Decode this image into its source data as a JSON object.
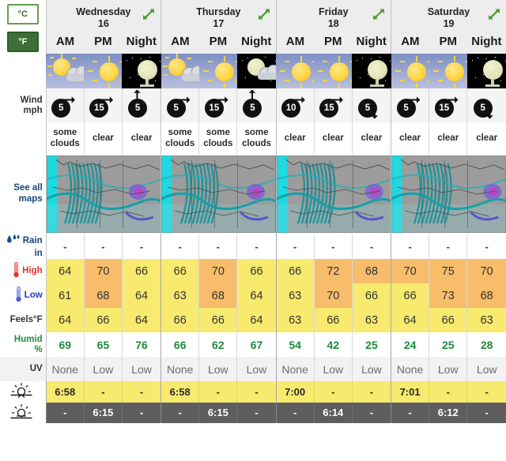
{
  "units": {
    "celsius_label": "°C",
    "fahrenheit_label": "°F",
    "selected": "°F"
  },
  "row_labels": {
    "wind": "Wind",
    "wind_unit": "mph",
    "see_all_maps": "See all\nmaps",
    "see_all_maps_line1": "See all",
    "see_all_maps_line2": "maps",
    "rain": "Rain",
    "rain_unit": "in",
    "high": "High",
    "low": "Low",
    "feels": "Feels°F",
    "humid": "Humid",
    "humid_unit": "%",
    "uv": "UV",
    "sunrise": "sunrise-icon",
    "sunset": "sunset-icon"
  },
  "days": [
    {
      "name": "Wednesday",
      "date": "16",
      "periods": [
        "AM",
        "PM",
        "Night"
      ],
      "sky": [
        "sun-cloud",
        "sun",
        "moon"
      ],
      "wind_speed": [
        "5",
        "15",
        "5"
      ],
      "wind_dir": [
        "ne",
        "ne",
        "n"
      ],
      "conditions": [
        "some clouds",
        "clear",
        "clear"
      ],
      "rain": [
        "-",
        "-",
        "-"
      ],
      "high": [
        "64",
        "70",
        "66"
      ],
      "high_hot": [
        false,
        true,
        false
      ],
      "low": [
        "61",
        "68",
        "64"
      ],
      "low_hot": [
        false,
        true,
        false
      ],
      "feels": [
        "64",
        "66",
        "64"
      ],
      "humid": [
        "69",
        "65",
        "76"
      ],
      "uv": [
        "None",
        "Low",
        "Low"
      ],
      "sunrise": [
        "6:58",
        "-",
        "-"
      ],
      "sunset": [
        "-",
        "6:15",
        "-"
      ]
    },
    {
      "name": "Thursday",
      "date": "17",
      "periods": [
        "AM",
        "PM",
        "Night"
      ],
      "sky": [
        "sun-cloud",
        "sun",
        "moon-cloud"
      ],
      "wind_speed": [
        "5",
        "15",
        "5"
      ],
      "wind_dir": [
        "ne",
        "ne",
        "n"
      ],
      "conditions": [
        "some clouds",
        "some clouds",
        "some clouds"
      ],
      "rain": [
        "-",
        "-",
        "-"
      ],
      "high": [
        "66",
        "70",
        "66"
      ],
      "high_hot": [
        false,
        true,
        false
      ],
      "low": [
        "63",
        "68",
        "64"
      ],
      "low_hot": [
        false,
        true,
        false
      ],
      "feels": [
        "66",
        "66",
        "64"
      ],
      "humid": [
        "66",
        "62",
        "67"
      ],
      "uv": [
        "None",
        "Low",
        "Low"
      ],
      "sunrise": [
        "6:58",
        "-",
        "-"
      ],
      "sunset": [
        "-",
        "6:15",
        "-"
      ]
    },
    {
      "name": "Friday",
      "date": "18",
      "periods": [
        "AM",
        "PM",
        "Night"
      ],
      "sky": [
        "sun",
        "sun",
        "moon"
      ],
      "wind_speed": [
        "10",
        "15",
        "5"
      ],
      "wind_dir": [
        "ne",
        "ne",
        "s"
      ],
      "conditions": [
        "clear",
        "clear",
        "clear"
      ],
      "rain": [
        "-",
        "-",
        "-"
      ],
      "high": [
        "66",
        "72",
        "68"
      ],
      "high_hot": [
        false,
        true,
        true
      ],
      "low": [
        "63",
        "70",
        "66"
      ],
      "low_hot": [
        false,
        true,
        false
      ],
      "feels": [
        "63",
        "66",
        "63"
      ],
      "humid": [
        "54",
        "42",
        "25"
      ],
      "uv": [
        "None",
        "Low",
        "Low"
      ],
      "sunrise": [
        "7:00",
        "-",
        "-"
      ],
      "sunset": [
        "-",
        "6:14",
        "-"
      ]
    },
    {
      "name": "Saturday",
      "date": "19",
      "periods": [
        "AM",
        "PM",
        "Night"
      ],
      "sky": [
        "sun",
        "sun",
        "moon"
      ],
      "wind_speed": [
        "5",
        "15",
        "5"
      ],
      "wind_dir": [
        "ne",
        "ne",
        "s"
      ],
      "conditions": [
        "clear",
        "clear",
        "clear"
      ],
      "rain": [
        "-",
        "-",
        "-"
      ],
      "high": [
        "70",
        "75",
        "70"
      ],
      "high_hot": [
        true,
        true,
        true
      ],
      "low": [
        "66",
        "73",
        "68"
      ],
      "low_hot": [
        false,
        true,
        true
      ],
      "feels": [
        "64",
        "66",
        "63"
      ],
      "humid": [
        "24",
        "25",
        "28"
      ],
      "uv": [
        "None",
        "Low",
        "Low"
      ],
      "sunrise": [
        "7:01",
        "-",
        "-"
      ],
      "sunset": [
        "-",
        "6:12",
        "-"
      ]
    }
  ],
  "colors": {
    "temp_warm": "#f7ea6e",
    "temp_hot": "#f7bd6b",
    "accent_green": "#3c7038",
    "link_blue": "#17457e",
    "high_label": "#e8342a",
    "low_label": "#2b39c4",
    "humid_label": "#1e8a3c",
    "sunset_bg": "#5e5e5e"
  },
  "icons": {
    "expand": "expand-arrows-icon",
    "raindrop": "raindrop-icon",
    "thermometer_hot": "thermometer-hot-icon",
    "thermometer_cold": "thermometer-cold-icon",
    "sunrise": "sunrise-icon",
    "sunset": "sunset-icon"
  }
}
